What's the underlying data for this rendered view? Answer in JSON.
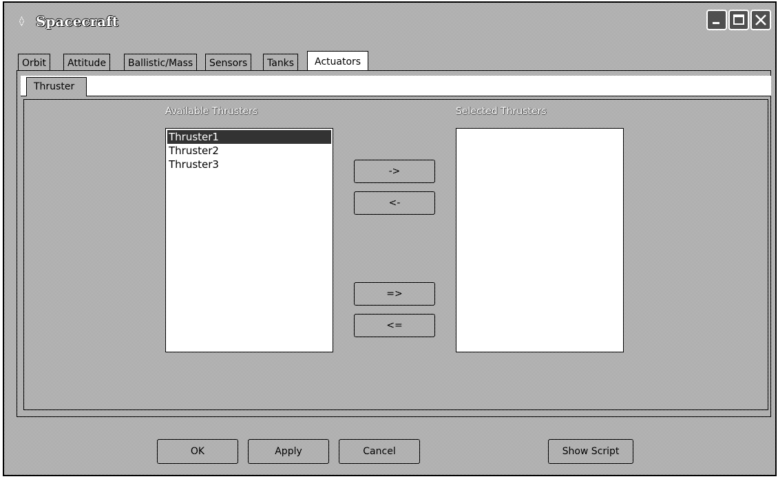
{
  "window": {
    "title": "Spacecraft"
  },
  "tabs": [
    "Orbit",
    "Attitude",
    "Ballistic/Mass",
    "Sensors",
    "Tanks",
    "Actuators"
  ],
  "active_tab": "Actuators",
  "subtabs": [
    "Thruster"
  ],
  "available": {
    "label": "Available Thrusters",
    "items": [
      "Thruster1",
      "Thruster2",
      "Thruster3"
    ],
    "selected_item": "Thruster1"
  },
  "selected": {
    "label": "Selected Thrusters",
    "items": []
  },
  "transfer_buttons": {
    "add": "->",
    "remove": "<-",
    "add_all": "=>",
    "remove_all": "<="
  },
  "footer": {
    "ok": "OK",
    "apply": "Apply",
    "cancel": "Cancel",
    "show_script": "Show Script"
  }
}
